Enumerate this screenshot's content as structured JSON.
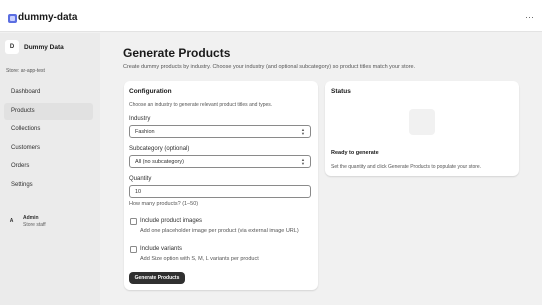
{
  "app": {
    "title": "dummy-data",
    "icon": "app-icon",
    "more_icon": "···"
  },
  "sidebar": {
    "store_initial": "D",
    "store_name": "Dummy Data",
    "store_id": "Store: ar-app-test",
    "items": [
      {
        "label": "Dashboard",
        "active": false
      },
      {
        "label": "Products",
        "active": true
      },
      {
        "label": "Collections",
        "active": false
      },
      {
        "label": "Customers",
        "active": false
      },
      {
        "label": "Orders",
        "active": false
      },
      {
        "label": "Settings",
        "active": false
      }
    ],
    "user_initial": "A",
    "user_name": "Admin",
    "user_role": "Store staff"
  },
  "page": {
    "title": "Generate Products",
    "subtitle": "Create dummy products by industry. Choose your industry (and optional subcategory) so product titles match your store."
  },
  "config": {
    "title": "Configuration",
    "hint": "Choose an industry to generate relevant product titles and types.",
    "industry_label": "Industry",
    "industry_value": "Fashion",
    "subcategory_label": "Subcategory (optional)",
    "subcategory_value": "All (no subcategory)",
    "quantity_label": "Quantity",
    "quantity_value": "10",
    "quantity_help": "How many products? (1–50)",
    "images_label": "Include product images",
    "images_help": "Add one placeholder image per product (via external image URL)",
    "variants_label": "Include variants",
    "variants_help": "Add Size option with S, M, L variants per product",
    "submit_label": "Generate Products"
  },
  "status": {
    "title": "Status",
    "heading": "Ready to generate",
    "text": "Set the quantity and click Generate Products to populate your store."
  },
  "colors": {
    "primary_button": "#303030",
    "background": "#f1f1f1",
    "app_icon": "#5b6ee1"
  }
}
